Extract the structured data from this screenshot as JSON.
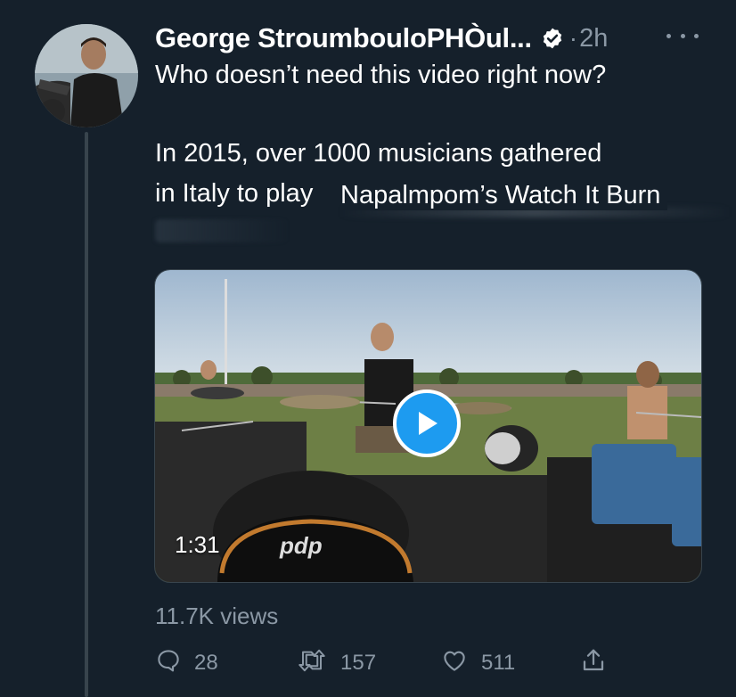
{
  "tweet": {
    "display_name": "George StroumbouloPHÒul...",
    "separator": "·",
    "time": "2h",
    "lines": [
      "Who doesn’t need this video right now?",
      "In 2015, over 1000 musicians gathered",
      "in Italy to play"
    ],
    "overlay_text": "Napalmpom’s Watch It Burn"
  },
  "video": {
    "duration": "1:31",
    "views": "11.7K views"
  },
  "actions": {
    "replies": "28",
    "retweets": "157",
    "likes": "511"
  },
  "colors": {
    "background": "#15202b",
    "secondary_text": "#8b98a5",
    "accent": "#1d9bf0"
  },
  "icons": [
    "avatar",
    "verified-badge-icon",
    "more-icon",
    "play-icon",
    "reply-icon",
    "retweet-icon",
    "like-icon",
    "share-icon"
  ]
}
